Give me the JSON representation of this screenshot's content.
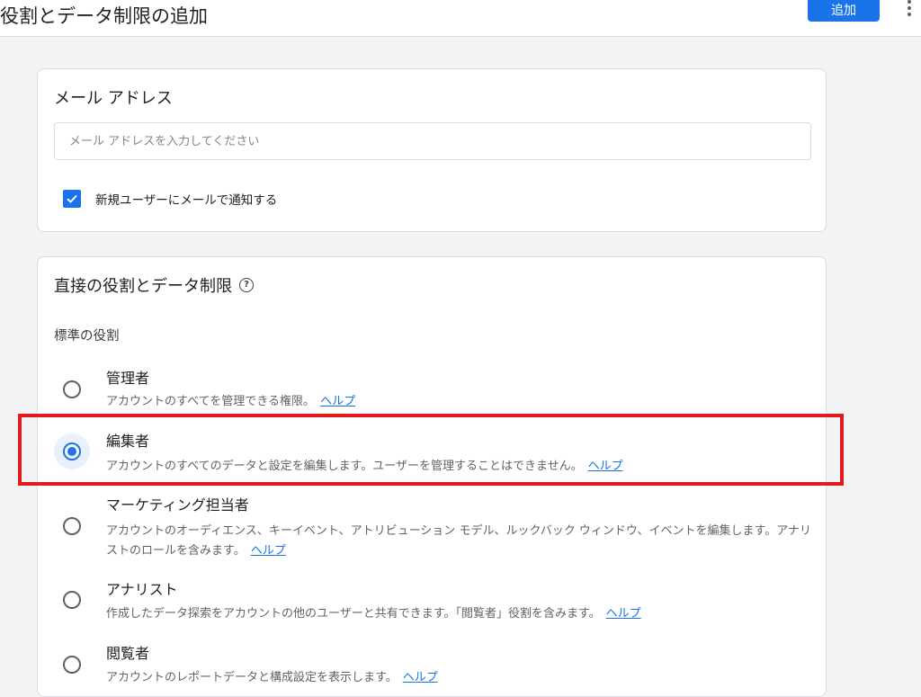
{
  "header": {
    "title": "役割とデータ制限の追加",
    "add_label": "追加",
    "more_icon": "more-vert-icon"
  },
  "email_card": {
    "title": "メール アドレス",
    "placeholder": "メール アドレスを入力してください",
    "value": "",
    "notify_checked": true,
    "notify_label": "新規ユーザーにメールで通知する"
  },
  "roles_card": {
    "title": "直接の役割とデータ制限",
    "help_icon": "help-circle-icon",
    "section_label": "標準の役割",
    "roles": [
      {
        "name": "管理者",
        "desc": "アカウントのすべてを管理できる権限。",
        "help": "ヘルプ",
        "selected": false
      },
      {
        "name": "編集者",
        "desc": "アカウントのすべてのデータと設定を編集します。ユーザーを管理することはできません。",
        "help": "ヘルプ",
        "selected": true
      },
      {
        "name": "マーケティング担当者",
        "desc": "アカウントのオーディエンス、キーイベント、アトリビューション モデル、ルックバック ウィンドウ、イベントを編集します。アナリストのロールを含みます。",
        "help": "ヘルプ",
        "selected": false
      },
      {
        "name": "アナリスト",
        "desc": "作成したデータ探索をアカウントの他のユーザーと共有できます。「閲覧者」役割を含みます。",
        "help": "ヘルプ",
        "selected": false
      },
      {
        "name": "閲覧者",
        "desc": "アカウントのレポートデータと構成設定を表示します。",
        "help": "ヘルプ",
        "selected": false
      }
    ]
  },
  "colors": {
    "accent": "#1a73e8",
    "highlight": "#e3191c"
  }
}
